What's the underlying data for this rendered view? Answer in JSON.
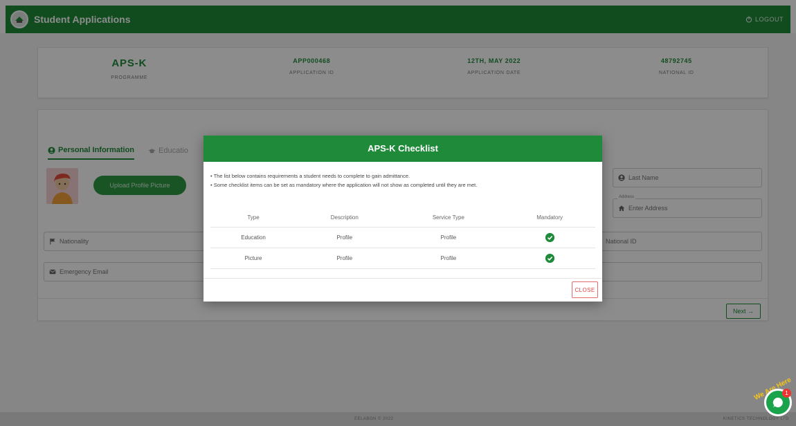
{
  "header": {
    "title": "Student Applications",
    "logout_label": "LOGOUT"
  },
  "summary": [
    {
      "value": "APS-K",
      "label": "PROGRAMME"
    },
    {
      "value": "APP000468",
      "label": "APPLICATION ID"
    },
    {
      "value": "12TH, MAY 2022",
      "label": "APPLICATION DATE"
    },
    {
      "value": "48792745",
      "label": "NATIONAL ID"
    }
  ],
  "tabs": [
    {
      "label": "Personal Information"
    },
    {
      "label": "Educatio"
    }
  ],
  "form": {
    "upload_label": "Upload Profile Picture",
    "last_name_placeholder": "Last Name",
    "address_legend": "Address",
    "address_placeholder": "Enter Address",
    "nationality_placeholder": "Nationality",
    "national_id_placeholder": "National ID",
    "emergency_email_placeholder": "Emergency Email",
    "next_label": "Next"
  },
  "modal": {
    "title": "APS-K Checklist",
    "notes": [
      "• The list below contains requirements a student needs to complete to gain admittance.",
      "• Some checklist items can be set as mandatory where the application will not show as completed until they are met."
    ],
    "columns": [
      "Type",
      "Description",
      "Service Type",
      "Mandatory"
    ],
    "rows": [
      {
        "type": "Education",
        "description": "Profile",
        "service_type": "Profile",
        "mandatory": true
      },
      {
        "type": "Picture",
        "description": "Profile",
        "service_type": "Profile",
        "mandatory": true
      }
    ],
    "close_label": "CLOSE"
  },
  "footer": {
    "copyright": "EELABON © 2022",
    "company": "KINETICS TECHNOLOGY LTD"
  },
  "chat": {
    "label": "We Are Here",
    "badge": "1"
  },
  "colors": {
    "brand_green": "#1f8a3a",
    "close_red": "#d44"
  }
}
